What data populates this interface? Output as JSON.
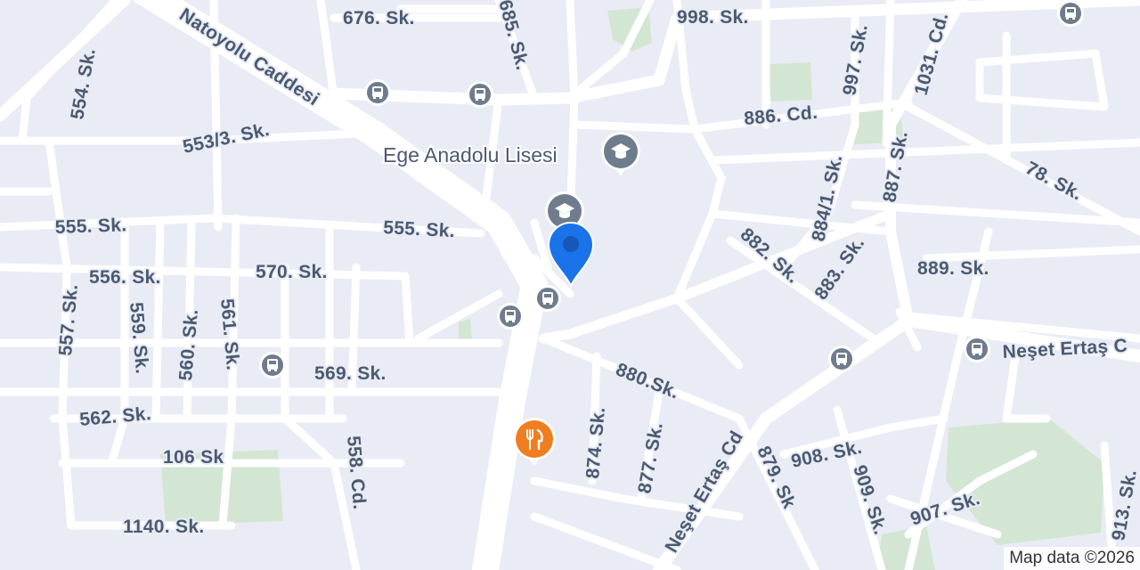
{
  "map": {
    "attribution": "Map data ©2026",
    "colors": {
      "background": "#e9ecf4",
      "road": "#ffffff",
      "park": "#d3e6d3",
      "label": "#4b5a72",
      "pin": "#1a73e8",
      "poi_gray": "#6f7c8d",
      "poi_food": "#f07d1f"
    }
  },
  "streets": {
    "s676": "676. Sk.",
    "s685": "685. Sk.",
    "s998": "998. Sk.",
    "s997": "997. Sk.",
    "s1031": "1031. Cd.",
    "natoyolu": "Natoyolu Caddesi",
    "s554": "554. Sk.",
    "s886": "886. Cd.",
    "s553_3": "553/3. Sk.",
    "s887": "887. Sk.",
    "s884_1": "884/1. Sk.",
    "s78": "78. Sk.",
    "s555a": "555. Sk.",
    "s555b": "555. Sk.",
    "s882": "882. Sk.",
    "s883": "883. Sk.",
    "s889": "889. Sk.",
    "s556": "556. Sk.",
    "s570": "570. Sk.",
    "s557": "557. Sk.",
    "s559": "559. Sk.",
    "s560": "560. Sk.",
    "s561": "561. Sk.",
    "neset_cd_right": "Neşet Ertaş C",
    "s569": "569. Sk.",
    "s880": "880.Sk.",
    "s562": "562. Sk.",
    "s874": "874. Sk.",
    "s877": "877. Sk.",
    "neset_cd": "Neşet Ertaş Cd",
    "s879": "879. Sk",
    "s908": "908. Sk.",
    "s106": "106 Sk",
    "s558": "558. Cd.",
    "s909": "909. Sk.",
    "s907": "907. Sk.",
    "s913": "913. Sk.",
    "s1140": "1140. Sk."
  },
  "pois": {
    "school_name": "Ege Anadolu Lisesi",
    "school_icon": "graduation-cap-icon",
    "restaurant_icon": "fork-knife-icon",
    "bus_icon": "bus-icon",
    "location_pin": "location-pin-icon"
  }
}
